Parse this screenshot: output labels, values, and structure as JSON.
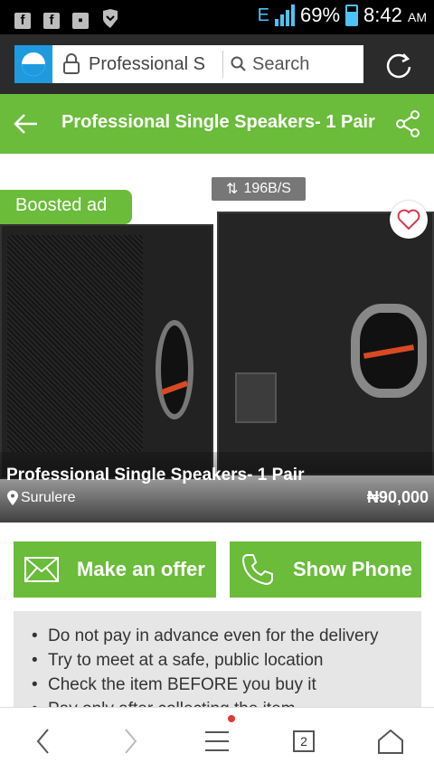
{
  "status_bar": {
    "network": "E",
    "battery": "69%",
    "time": "8:42",
    "ampm": "AM"
  },
  "browser": {
    "url_text": "Professional S",
    "search_label": "Search"
  },
  "header": {
    "title": "Professional Single Speakers- 1 Pair"
  },
  "speed_badge": "196B/S",
  "listing": {
    "badge": "Boosted ad",
    "title": "Professional Single Speakers- 1 Pair",
    "location": "Surulere",
    "price": "₦90,000"
  },
  "actions": {
    "offer_label": "Make an offer",
    "phone_label": "Show Phone"
  },
  "safety_tips": [
    "Do not pay in advance even for the delivery",
    "Try to meet at a safe, public location",
    "Check the item BEFORE you buy it",
    "Pay only after collecting the item"
  ],
  "bottom_nav": {
    "tab_count": "2"
  },
  "colors": {
    "accent": "#6abc3a",
    "site_icon": "#1e9be0",
    "tips_bg": "#e6e6e6"
  }
}
